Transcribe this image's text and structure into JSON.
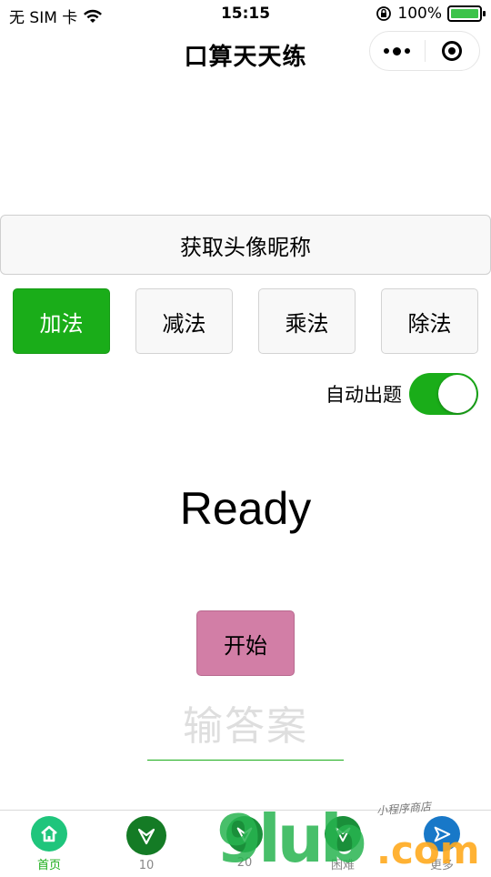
{
  "status_bar": {
    "carrier": "无 SIM 卡",
    "time": "15:15",
    "battery_percent": "100%",
    "battery_level": 1.0
  },
  "nav": {
    "title": "口算天天练"
  },
  "main": {
    "profile_button": "获取头像昵称",
    "operations": [
      {
        "label": "加法",
        "active": true
      },
      {
        "label": "减法",
        "active": false
      },
      {
        "label": "乘法",
        "active": false
      },
      {
        "label": "除法",
        "active": false
      }
    ],
    "auto_question_label": "自动出题",
    "auto_question_on": true,
    "question_text": "Ready",
    "start_button": "开始",
    "answer_placeholder": "输答案"
  },
  "tabbar": {
    "tabs": [
      {
        "label": "首页",
        "icon": "home-icon",
        "color": "#1fc57c",
        "active": true
      },
      {
        "label": "10",
        "icon": "chevron-down-arrow-icon",
        "color": "#147b25",
        "active": false
      },
      {
        "label": "20",
        "icon": "chevron-down-arrow-icon",
        "color": "#1a8f3a",
        "active": false
      },
      {
        "label": "困难",
        "icon": "chevron-down-arrow-icon",
        "color": "#1a8f3a",
        "active": false
      },
      {
        "label": "更多",
        "icon": "send-arrow-icon",
        "color": "#1878c8",
        "active": false
      }
    ]
  },
  "watermark": {
    "big": "9lub",
    "com": ".com",
    "small": "小程序商店"
  },
  "colors": {
    "accent": "#1aad19",
    "start_button": "#d27ea6"
  }
}
